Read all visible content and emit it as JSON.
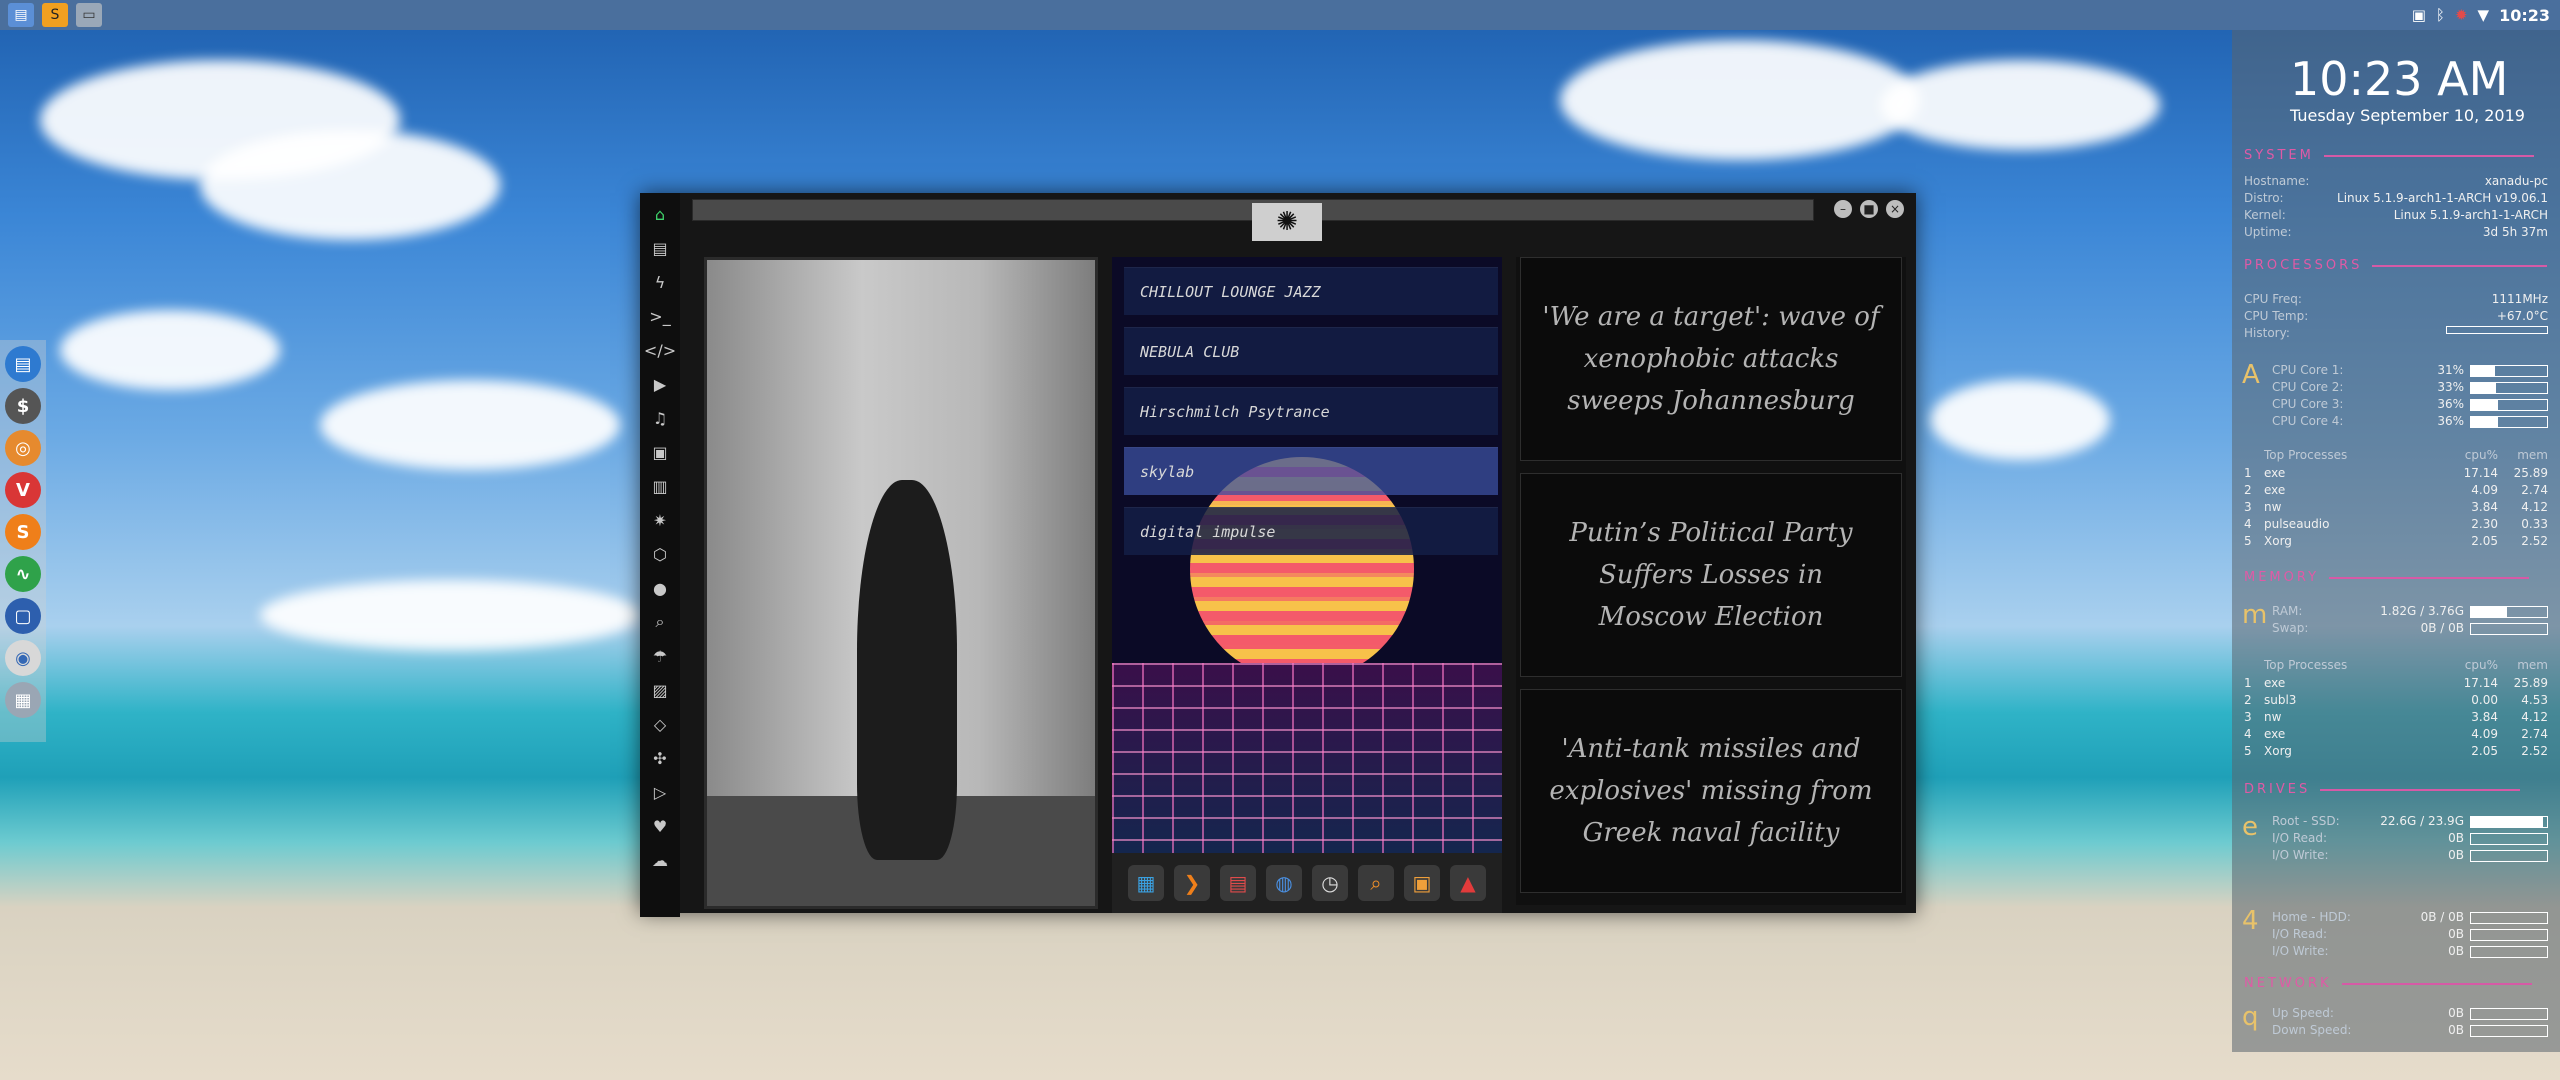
{
  "top_panel": {
    "launchers": [
      "file-manager-icon",
      "sublime-text-icon",
      "workspace-icon"
    ],
    "tray_icons": [
      "image-icon",
      "bluetooth-icon",
      "alert-icon",
      "wifi-icon"
    ],
    "time": "10:23"
  },
  "left_dock": [
    "files-icon",
    "money-icon",
    "ubuntu-icon",
    "vivaldi-icon",
    "sublime-icon",
    "activity-monitor-icon",
    "screen-icon",
    "chrome-icon",
    "network-icon"
  ],
  "window": {
    "side_icons": [
      "home-icon",
      "document-icon",
      "lightning-icon",
      "terminal-icon",
      "code-icon",
      "play-icon",
      "music-file-icon",
      "image-icon",
      "news-icon",
      "settings-icon",
      "hexagon-icon",
      "globe-icon",
      "search-icon",
      "umbrella-icon",
      "contact-icon",
      "share-icon",
      "expand-icon",
      "youtube-icon",
      "heart-icon",
      "cloud-icon"
    ],
    "buttons": [
      "minimize",
      "maximize",
      "close"
    ]
  },
  "music": {
    "stations": [
      "CHILLOUT LOUNGE JAZZ",
      "NEBULA CLUB",
      "Hirschmilch Psytrance",
      "skylab",
      "digital impulse"
    ],
    "selected_index": 3,
    "toolbar": [
      "grid-app-icon",
      "forward-icon",
      "calendar-icon",
      "globe-icon",
      "clock-icon",
      "search-icon",
      "picture-icon",
      "app-a-icon"
    ]
  },
  "news": [
    "'We are a target': wave of xenophobic attacks sweeps Johannesburg",
    "Putin’s Political Party Suffers Losses in Moscow Election",
    "'Anti-tank missiles and explosives' missing from Greek naval facility"
  ],
  "conky": {
    "time": "10:23 AM",
    "date": "Tuesday September 10, 2019",
    "system_label": "SYSTEM",
    "system": [
      {
        "k": "Hostname:",
        "v": "xanadu-pc"
      },
      {
        "k": "Distro:",
        "v": "Linux 5.1.9-arch1-1-ARCH v19.06.1"
      },
      {
        "k": "Kernel:",
        "v": "Linux 5.1.9-arch1-1-ARCH"
      },
      {
        "k": "Uptime:",
        "v": "3d 5h 37m"
      }
    ],
    "processors_label": "PROCESSORS",
    "cpu_freq": {
      "k": "CPU Freq:",
      "v": "1111MHz"
    },
    "cpu_temp": {
      "k": "CPU Temp:",
      "v": "+67.0°C"
    },
    "history": {
      "k": "History:"
    },
    "cores": [
      {
        "k": "CPU Core 1:",
        "v": "31%",
        "pct": 0.31
      },
      {
        "k": "CPU Core 2:",
        "v": "33%",
        "pct": 0.33
      },
      {
        "k": "CPU Core 3:",
        "v": "36%",
        "pct": 0.36
      },
      {
        "k": "CPU Core 4:",
        "v": "36%",
        "pct": 0.36
      }
    ],
    "top_processes_label": "Top Processes",
    "cpu_head": "cpu%",
    "mem_head": "mem",
    "cpu_procs": [
      {
        "n": "1",
        "name": "exe",
        "cpu": "17.14",
        "mem": "25.89"
      },
      {
        "n": "2",
        "name": "exe",
        "cpu": "4.09",
        "mem": "2.74"
      },
      {
        "n": "3",
        "name": "nw",
        "cpu": "3.84",
        "mem": "4.12"
      },
      {
        "n": "4",
        "name": "pulseaudio",
        "cpu": "2.30",
        "mem": "0.33"
      },
      {
        "n": "5",
        "name": "Xorg",
        "cpu": "2.05",
        "mem": "2.52"
      }
    ],
    "memory_label": "MEMORY",
    "ram": {
      "k": "RAM:",
      "v": "1.82G / 3.76G",
      "pct": 0.48
    },
    "swap": {
      "k": "Swap:",
      "v": "0B / 0B",
      "pct": 0
    },
    "mem_procs": [
      {
        "n": "1",
        "name": "exe",
        "cpu": "17.14",
        "mem": "25.89"
      },
      {
        "n": "2",
        "name": "subl3",
        "cpu": "0.00",
        "mem": "4.53"
      },
      {
        "n": "3",
        "name": "nw",
        "cpu": "3.84",
        "mem": "4.12"
      },
      {
        "n": "4",
        "name": "exe",
        "cpu": "4.09",
        "mem": "2.74"
      },
      {
        "n": "5",
        "name": "Xorg",
        "cpu": "2.05",
        "mem": "2.52"
      }
    ],
    "drives_label": "DRIVES",
    "drive1": [
      {
        "k": "Root - SSD:",
        "v": "22.6G / 23.9G",
        "pct": 0.95
      },
      {
        "k": "I/O Read:",
        "v": "0B",
        "pct": 0
      },
      {
        "k": "I/O Write:",
        "v": "0B",
        "pct": 0
      }
    ],
    "drive2": [
      {
        "k": "Home - HDD:",
        "v": "0B / 0B",
        "pct": 0
      },
      {
        "k": "I/O Read:",
        "v": "0B",
        "pct": 0
      },
      {
        "k": "I/O Write:",
        "v": "0B",
        "pct": 0
      }
    ],
    "network_label": "NETWORK",
    "network": [
      {
        "k": "Up Speed:",
        "v": "0B",
        "pct": 0
      },
      {
        "k": "Down Speed:",
        "v": "0B",
        "pct": 0
      }
    ]
  }
}
